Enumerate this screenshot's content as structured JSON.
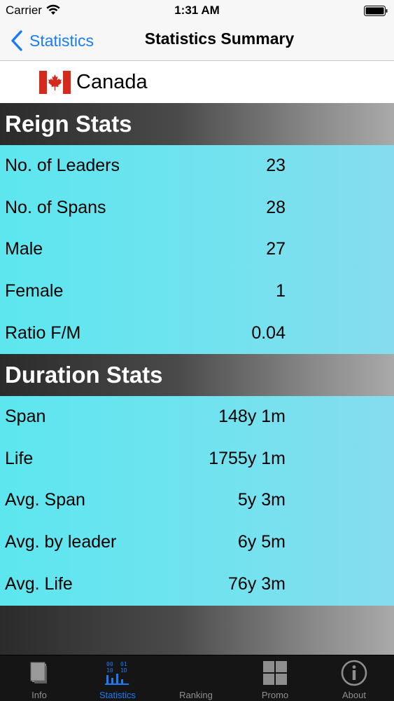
{
  "status_bar": {
    "carrier": "Carrier",
    "time": "1:31 AM"
  },
  "nav": {
    "back_label": "Statistics",
    "title": "Statistics Summary"
  },
  "country": {
    "name": "Canada"
  },
  "reign": {
    "title": "Reign Stats",
    "rows": [
      {
        "label": "No. of Leaders",
        "value": "23"
      },
      {
        "label": "No. of Spans",
        "value": "28"
      },
      {
        "label": "Male",
        "value": "27"
      },
      {
        "label": "Female",
        "value": "1"
      },
      {
        "label": "Ratio F/M",
        "value": "0.04"
      }
    ]
  },
  "duration": {
    "title": "Duration Stats",
    "rows": [
      {
        "label": "Span",
        "value": "148y 1m"
      },
      {
        "label": "Life",
        "value": "1755y 1m"
      },
      {
        "label": "Avg. Span",
        "value": "5y 3m"
      },
      {
        "label": "Avg. by leader",
        "value": "6y 5m"
      },
      {
        "label": "Avg. Life",
        "value": "76y 3m"
      }
    ]
  },
  "tabs": [
    {
      "label": "Info",
      "icon": "book-icon",
      "active": false
    },
    {
      "label": "Statistics",
      "icon": "binary-chart-icon",
      "active": true
    },
    {
      "label": "Ranking",
      "icon": "",
      "active": false
    },
    {
      "label": "Promo",
      "icon": "grid-icon",
      "active": false
    },
    {
      "label": "About",
      "icon": "info-icon",
      "active": false
    }
  ],
  "colors": {
    "accent": "#1a7cf5",
    "row_bg": "#6fe3ef",
    "flag_red": "#d52b1e"
  }
}
